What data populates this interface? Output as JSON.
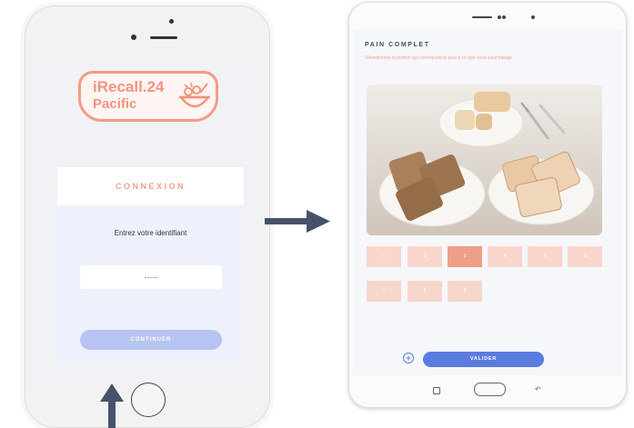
{
  "phone": {
    "logo": {
      "line1": "iRecall.24",
      "line2": "Pacific"
    },
    "login": {
      "title": "CONNEXION",
      "prompt": "Entrez votre identifiant",
      "id_placeholder": "-----",
      "continue_label": "CONTINUER"
    }
  },
  "tablet": {
    "food_title": "PAIN COMPLET",
    "instruction": "Sélectionnez la portion qui correspond le plus à ce que vous avez mangé.",
    "portion_buttons": [
      {
        "label": "1",
        "selected": false
      },
      {
        "label": "2",
        "selected": false
      },
      {
        "label": "3",
        "selected": true
      },
      {
        "label": "4",
        "selected": false
      },
      {
        "label": "5",
        "selected": false
      },
      {
        "label": "6",
        "selected": false
      },
      {
        "label": "7",
        "selected": false
      },
      {
        "label": "8",
        "selected": false
      },
      {
        "label": "9",
        "selected": false
      }
    ],
    "plus_label": "+",
    "validate_label": "VALIDER"
  },
  "colors": {
    "accent_orange": "#f2957e",
    "button_blue": "#5a7be0",
    "button_blue_light": "#b7c4f2",
    "portion_selected": "#ee9f89",
    "portion_unselected": "#f8d6cc",
    "arrow": "#46526b"
  },
  "icons": [
    "home-button-icon",
    "arrow-right-icon",
    "arrow-up-icon",
    "plus-icon",
    "nav-recent-icon",
    "nav-home-icon",
    "nav-back-icon",
    "food-bowl-icon"
  ]
}
